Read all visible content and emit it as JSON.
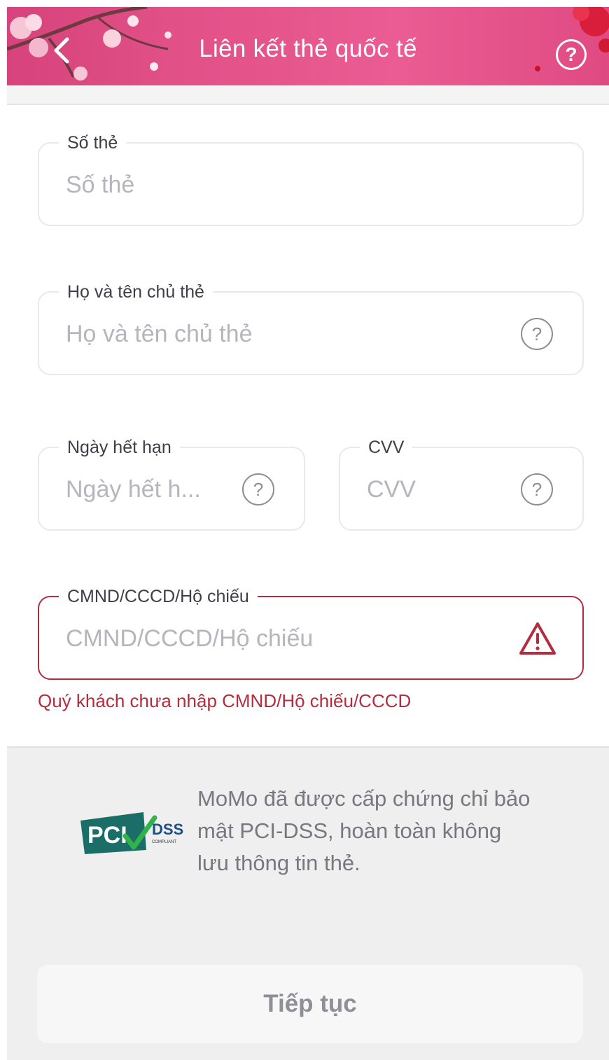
{
  "header": {
    "title": "Liên kết thẻ quốc tế",
    "back_icon": "chevron-left-icon",
    "help_icon": "question-circle-icon",
    "help_glyph": "?"
  },
  "form": {
    "card_number": {
      "label": "Số thẻ",
      "placeholder": "Số thẻ",
      "value": ""
    },
    "card_holder": {
      "label": "Họ và tên chủ thẻ",
      "placeholder": "Họ và tên chủ thẻ",
      "value": "",
      "help_glyph": "?"
    },
    "expiry": {
      "label": "Ngày hết hạn",
      "placeholder": "Ngày hết h...",
      "value": "",
      "help_glyph": "?"
    },
    "cvv": {
      "label": "CVV",
      "placeholder": "CVV",
      "value": "",
      "help_glyph": "?"
    },
    "id_number": {
      "label": "CMND/CCCD/Hộ chiếu",
      "placeholder": "CMND/CCCD/Hộ chiếu",
      "value": "",
      "error": "Quý khách chưa nhập CMND/Hộ chiếu/CCCD",
      "error_icon": "warning-triangle-icon"
    }
  },
  "security": {
    "logo_text_pci": "PCI",
    "logo_text_dss": "DSS",
    "logo_text_compliant": "COMPLIANT",
    "text": "MoMo đã được cấp chứng chỉ bảo mật PCI-DSS, hoàn toàn không lưu thông tin thẻ."
  },
  "actions": {
    "continue_label": "Tiếp tục"
  },
  "colors": {
    "header": "#e04a83",
    "error": "#b32d3f",
    "placeholder": "#b5b5bd"
  }
}
